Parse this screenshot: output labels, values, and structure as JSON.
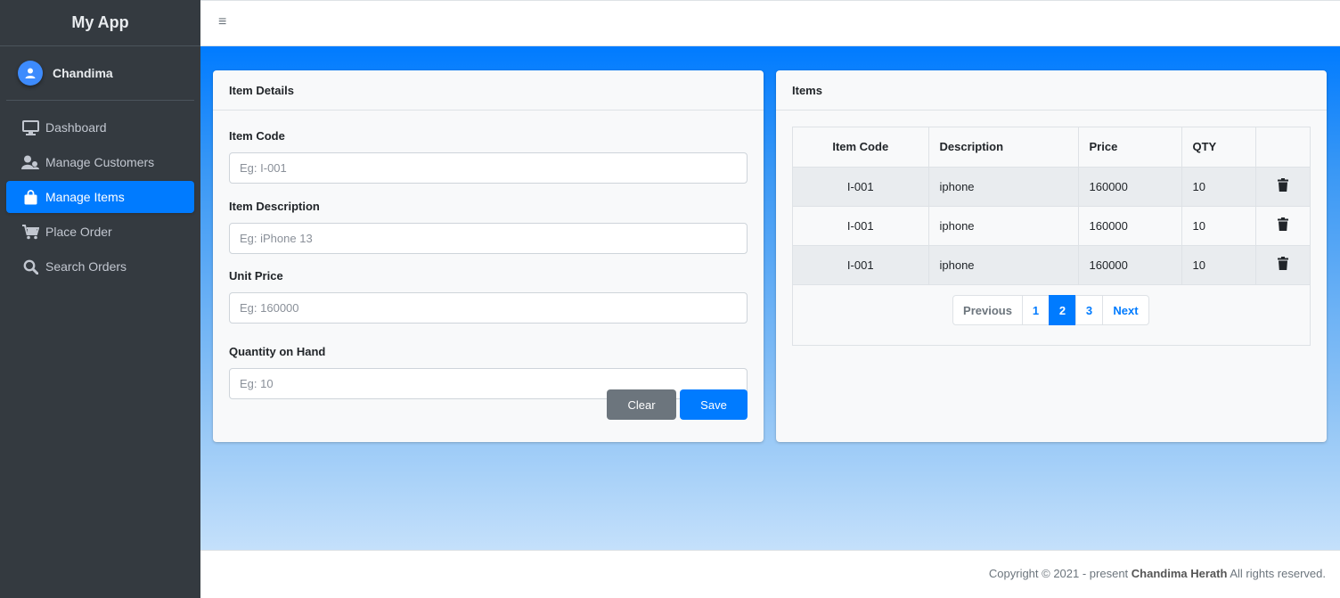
{
  "app": {
    "title": "My App"
  },
  "user": {
    "name": "Chandima"
  },
  "sidebar": {
    "items": [
      {
        "label": "Dashboard",
        "icon": "monitor-icon",
        "active": false
      },
      {
        "label": "Manage Customers",
        "icon": "users-icon",
        "active": false
      },
      {
        "label": "Manage Items",
        "icon": "shopping-bag-icon",
        "active": true
      },
      {
        "label": "Place Order",
        "icon": "cart-icon",
        "active": false
      },
      {
        "label": "Search Orders",
        "icon": "search-icon",
        "active": false
      }
    ]
  },
  "topbar": {
    "menu_icon": "hamburger-icon",
    "menu_glyph": "≡"
  },
  "item_form": {
    "title": "Item Details",
    "fields": [
      {
        "label": "Item Code",
        "placeholder": "Eg: I-001",
        "value": ""
      },
      {
        "label": "Item Description",
        "placeholder": "Eg: iPhone 13",
        "value": ""
      },
      {
        "label": "Unit Price",
        "placeholder": "Eg: 160000",
        "value": ""
      },
      {
        "label": "Quantity on Hand",
        "placeholder": "Eg: 10",
        "value": ""
      }
    ],
    "clear_label": "Clear",
    "save_label": "Save"
  },
  "items_table": {
    "title": "Items",
    "columns": [
      "Item Code",
      "Description",
      "Price",
      "QTY",
      ""
    ],
    "rows": [
      {
        "code": "I-001",
        "description": "iphone",
        "price": "160000",
        "qty": "10"
      },
      {
        "code": "I-001",
        "description": "iphone",
        "price": "160000",
        "qty": "10"
      },
      {
        "code": "I-001",
        "description": "iphone",
        "price": "160000",
        "qty": "10"
      }
    ],
    "delete_icon": "trash-icon",
    "pagination": {
      "previous": "Previous",
      "pages": [
        "1",
        "2",
        "3"
      ],
      "current": "2",
      "next": "Next"
    }
  },
  "footer": {
    "prefix": "Copyright © 2021 - present",
    "author": "Chandima Herath",
    "suffix": "All rights reserved."
  },
  "colors": {
    "primary": "#007bff",
    "sidebar": "#343a40",
    "secondary": "#6c757d"
  }
}
